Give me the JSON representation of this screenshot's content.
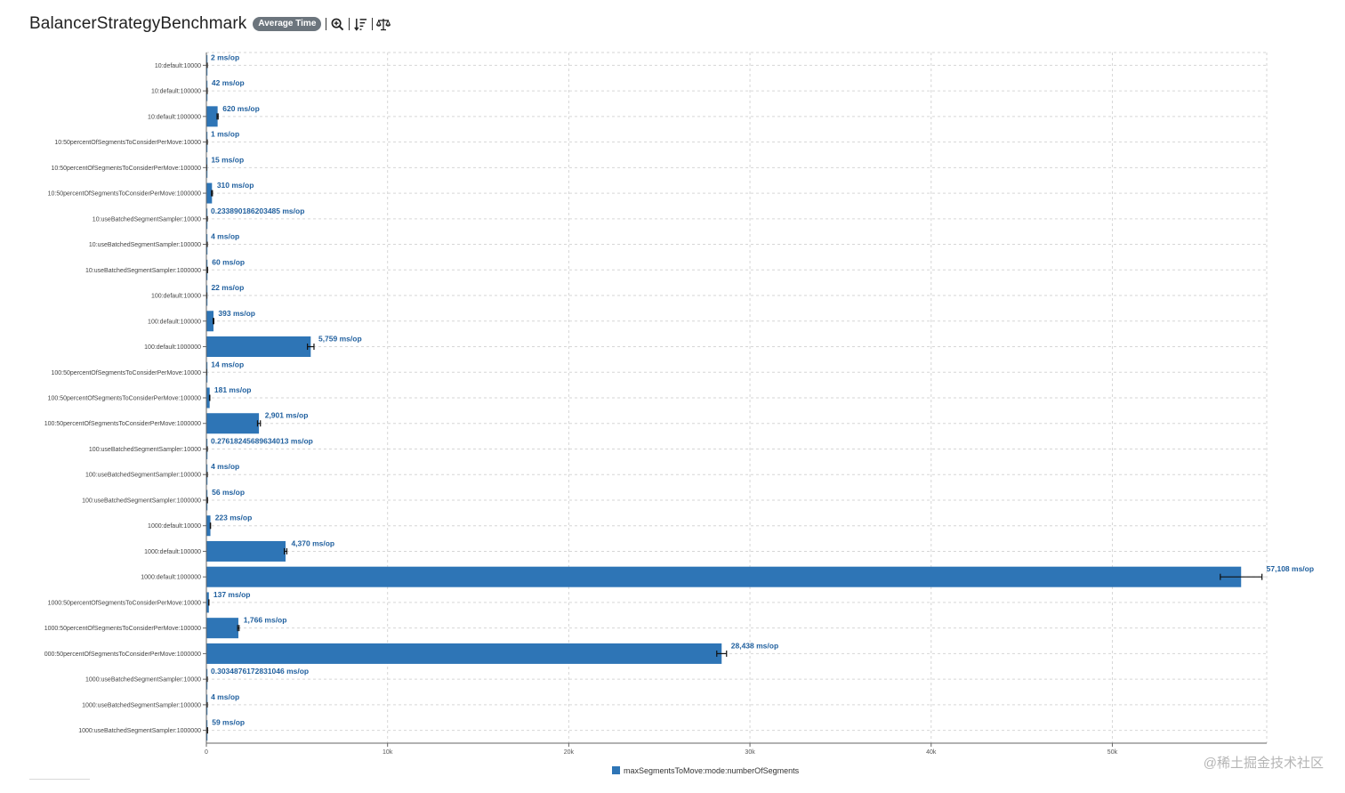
{
  "header": {
    "title": "BalancerStrategyBenchmark",
    "mode_badge": "Average Time",
    "tools": [
      "zoom-in-icon",
      "sort-descending-icon",
      "balance-scale-icon"
    ]
  },
  "chart_data": {
    "type": "bar",
    "orientation": "horizontal",
    "unit_suffix": "ms/op",
    "xlim": [
      0,
      58520
    ],
    "xticks": [
      0,
      10000,
      20000,
      30000,
      40000,
      50000
    ],
    "xtick_labels": [
      "0",
      "10k",
      "20k",
      "30k",
      "40k",
      "50k"
    ],
    "grid": true,
    "legend_position": "bottom-center",
    "bar_color": "#2e75b6",
    "categories": [
      "10:default:10000",
      "10:default:100000",
      "10:default:1000000",
      "10:50percentOfSegmentsToConsiderPerMove:10000",
      "10:50percentOfSegmentsToConsiderPerMove:100000",
      "10:50percentOfSegmentsToConsiderPerMove:1000000",
      "10:useBatchedSegmentSampler:10000",
      "10:useBatchedSegmentSampler:100000",
      "10:useBatchedSegmentSampler:1000000",
      "100:default:10000",
      "100:default:100000",
      "100:default:1000000",
      "100:50percentOfSegmentsToConsiderPerMove:10000",
      "100:50percentOfSegmentsToConsiderPerMove:100000",
      "100:50percentOfSegmentsToConsiderPerMove:1000000",
      "100:useBatchedSegmentSampler:10000",
      "100:useBatchedSegmentSampler:100000",
      "100:useBatchedSegmentSampler:1000000",
      "1000:default:10000",
      "1000:default:100000",
      "1000:default:1000000",
      "1000:50percentOfSegmentsToConsiderPerMove:10000",
      "1000:50percentOfSegmentsToConsiderPerMove:100000",
      "000:50percentOfSegmentsToConsiderPerMove:1000000",
      "1000:useBatchedSegmentSampler:10000",
      "1000:useBatchedSegmentSampler:100000",
      "1000:useBatchedSegmentSampler:1000000"
    ],
    "values": [
      2,
      42,
      620,
      1,
      15,
      310,
      0.233890186203485,
      4,
      60,
      22,
      393,
      5759,
      14,
      181,
      2901,
      0.27618245689634013,
      4,
      56,
      223,
      4370,
      57108,
      137,
      1766,
      28438,
      0.3034876172831046,
      4,
      59
    ],
    "value_labels": [
      "2 ms/op",
      "42 ms/op",
      "620 ms/op",
      "1 ms/op",
      "15 ms/op",
      "310 ms/op",
      "0.233890186203485 ms/op",
      "4 ms/op",
      "60 ms/op",
      "22 ms/op",
      "393 ms/op",
      "5,759 ms/op",
      "14 ms/op",
      "181 ms/op",
      "2,901 ms/op",
      "0.27618245689634013 ms/op",
      "4 ms/op",
      "56 ms/op",
      "223 ms/op",
      "4,370 ms/op",
      "57,108 ms/op",
      "137 ms/op",
      "1,766 ms/op",
      "28,438 ms/op",
      "0.3034876172831046 ms/op",
      "4 ms/op",
      "59 ms/op"
    ],
    "errors": [
      0,
      1,
      30,
      0,
      1,
      25,
      0,
      0,
      2,
      1,
      20,
      180,
      1,
      10,
      80,
      0,
      0,
      2,
      8,
      70,
      1150,
      5,
      40,
      270,
      0,
      0,
      2
    ],
    "legend": [
      "maxSegmentsToMove:mode:numberOfSegments"
    ]
  },
  "watermark": "@稀土掘金技术社区"
}
